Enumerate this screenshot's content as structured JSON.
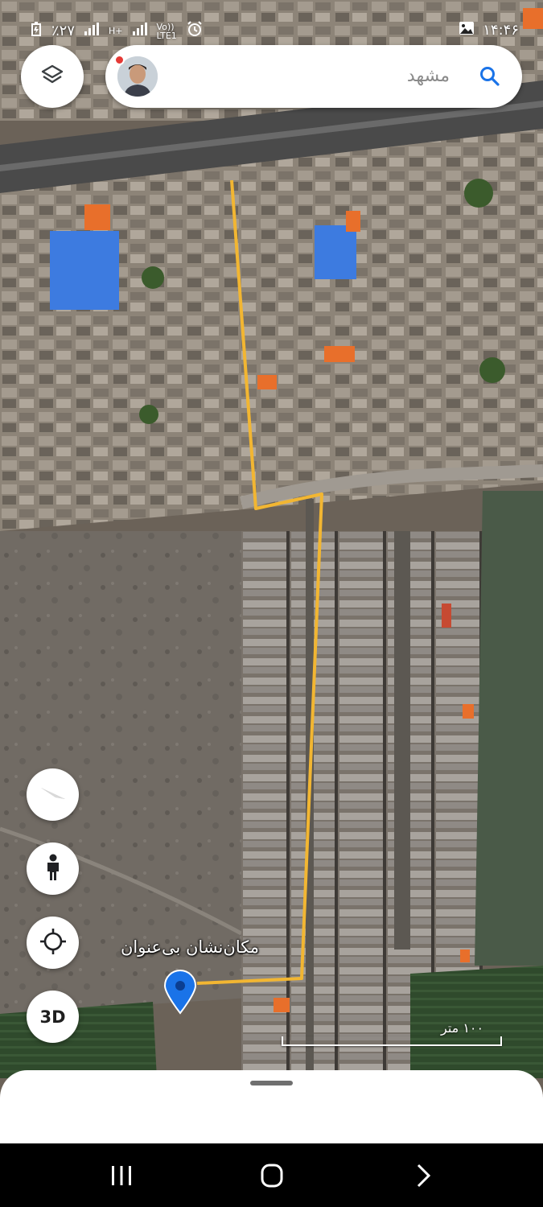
{
  "status_bar": {
    "battery": "٪۲۷",
    "network_left": "H+",
    "network_lte_top": "Vo))",
    "network_lte_bottom": "LTE1",
    "time": "۱۴:۴۶"
  },
  "search": {
    "placeholder": "مشهد",
    "icon": "search-icon"
  },
  "controls": {
    "layers": "layers-icon",
    "compass": "compass-icon",
    "street_view": "pegman-icon",
    "my_location": "my-location-icon",
    "view_3d_label": "3D"
  },
  "map": {
    "view": "satellite",
    "pin_label": "مکان‌نشان بی‌عنوان",
    "scale_label": "۱۰۰ متر",
    "route_color": "#f2b632",
    "pin_color": "#1a73e8",
    "roof_blue": "#3d7be0",
    "roof_orange": "#e86f2b"
  },
  "nav_bar": {
    "recents": "recents-icon",
    "home": "home-icon",
    "back": "back-icon"
  }
}
